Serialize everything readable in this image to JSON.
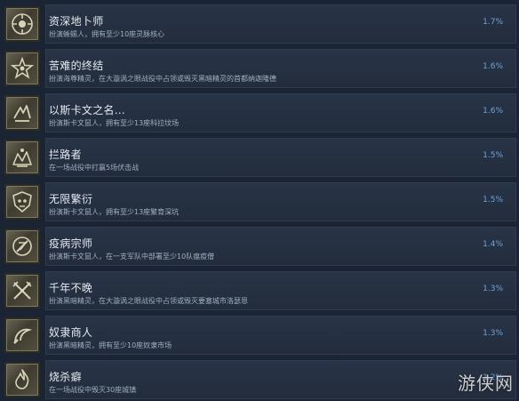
{
  "achievements": [
    {
      "title": "资深地卜师",
      "desc": "扮演蜥蜴人，拥有至少10座灵脉核心",
      "pct": "1.7%",
      "icon": "seer-icon"
    },
    {
      "title": "苦难的终结",
      "desc": "扮演海尊精灵，在大漩涡之眼战役中占领或毁灭黑暗精灵的首都纳迦隆德",
      "pct": "1.6%",
      "icon": "star-medal-icon"
    },
    {
      "title": "以斯卡文之名…",
      "desc": "扮演斯卡文鼠人，拥有至少13座科拉坟场",
      "pct": "1.6%",
      "icon": "rat-claw-icon"
    },
    {
      "title": "拦路者",
      "desc": "在一场战役中打赢5场伏击战",
      "pct": "1.5%",
      "icon": "ambush-icon"
    },
    {
      "title": "无限繁衍",
      "desc": "扮演斯卡文鼠人，拥有至少13座繁育深坑",
      "pct": "1.5%",
      "icon": "skull-shield-icon"
    },
    {
      "title": "疫病宗师",
      "desc": "扮演斯卡文鼠人，在一支军队中部署至少10队瘟疫僧",
      "pct": "1.4%",
      "icon": "plague-icon"
    },
    {
      "title": "千年不晚",
      "desc": "扮演黑暗精灵，在大漩涡之眼战役中占领或毁灭要塞城市洛瑟恩",
      "pct": "1.3%",
      "icon": "crossed-swords-icon"
    },
    {
      "title": "奴隶商人",
      "desc": "扮演黑暗精灵，拥有至少10座奴隶市场",
      "pct": "1.3%",
      "icon": "whip-icon"
    },
    {
      "title": "烧杀癖",
      "desc": "在一场战役中毁灭30座城镇",
      "pct": "1.2%",
      "icon": "flame-icon"
    }
  ],
  "watermark": "游侠网"
}
